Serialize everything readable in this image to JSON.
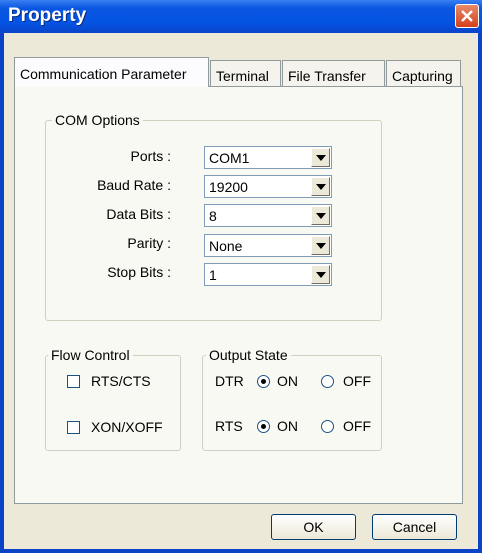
{
  "window": {
    "title": "Property"
  },
  "tabs": [
    {
      "label": "Communication Parameter",
      "active": true
    },
    {
      "label": "Terminal",
      "active": false
    },
    {
      "label": "File Transfer",
      "active": false
    },
    {
      "label": "Capturing",
      "active": false
    }
  ],
  "com_options": {
    "legend": "COM Options",
    "fields": [
      {
        "label": "Ports :",
        "value": "COM1"
      },
      {
        "label": "Baud Rate :",
        "value": "19200"
      },
      {
        "label": "Data Bits :",
        "value": "8"
      },
      {
        "label": "Parity :",
        "value": "None"
      },
      {
        "label": "Stop Bits :",
        "value": "1"
      }
    ]
  },
  "flow_control": {
    "legend": "Flow Control",
    "rts_cts": {
      "label": "RTS/CTS",
      "checked": false
    },
    "xon_xoff": {
      "label": "XON/XOFF",
      "checked": false
    }
  },
  "output_state": {
    "legend": "Output State",
    "dtr": {
      "label": "DTR",
      "on_label": "ON",
      "off_label": "OFF",
      "value": "ON"
    },
    "rts": {
      "label": "RTS",
      "on_label": "ON",
      "off_label": "OFF",
      "value": "ON"
    }
  },
  "buttons": {
    "ok": "OK",
    "cancel": "Cancel"
  },
  "colors": {
    "titlebar": "#0454e4",
    "close_button": "#d4401a",
    "dialog_bg": "#ece9d8"
  }
}
